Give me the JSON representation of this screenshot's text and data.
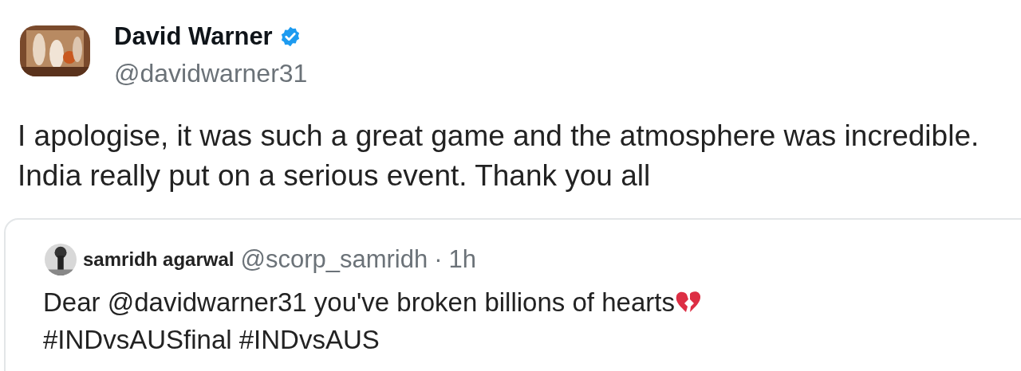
{
  "author": {
    "name": "David Warner",
    "verified": true,
    "handle": "@davidwarner31"
  },
  "text": [
    "I apologise, it was such a great game and the atmosphere was incredible.",
    "India really put on a serious event. Thank you all"
  ],
  "quoted": {
    "name": "samridh agarwal",
    "handle": "@scorp_samridh",
    "separator": "·",
    "time": "1h",
    "text": [
      "Dear @davidwarner31 you've broken billions of hearts",
      "#INDvsAUSfinal #INDvsAUS"
    ],
    "emoji": {
      "kind": "broken-heart"
    }
  }
}
